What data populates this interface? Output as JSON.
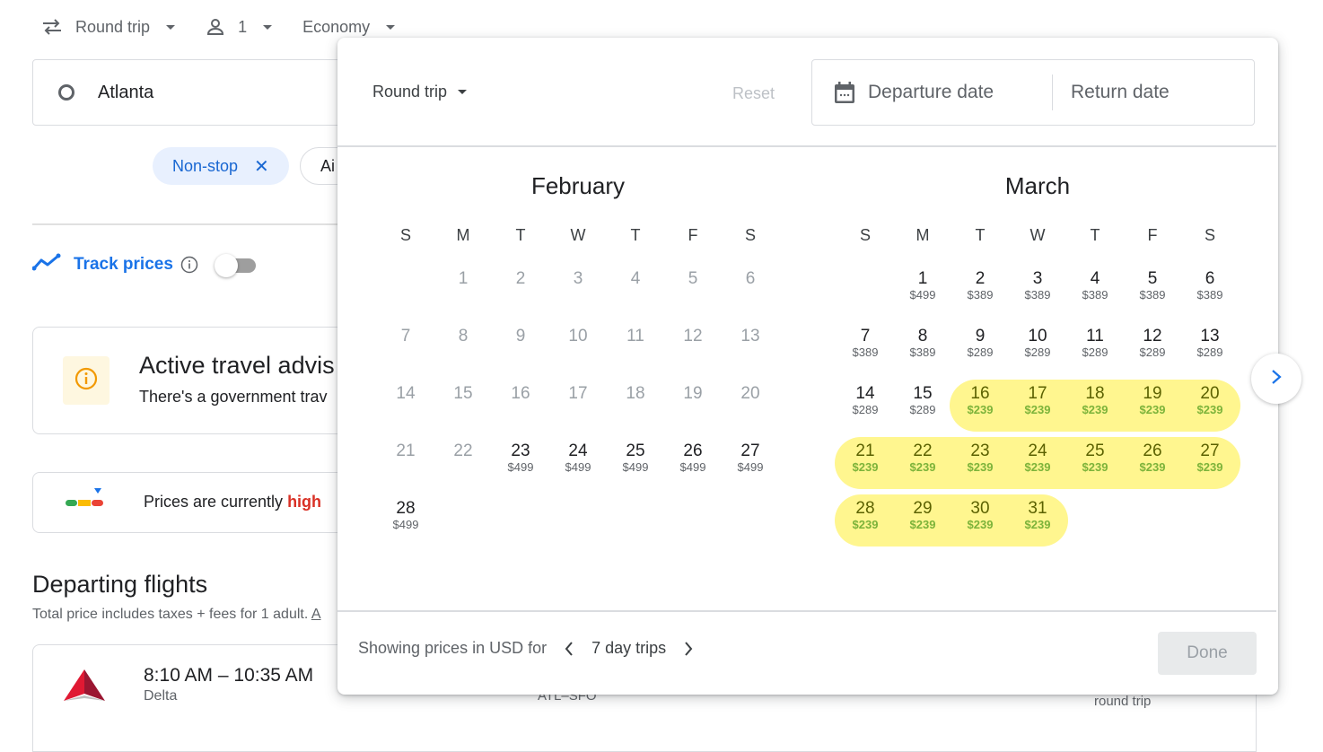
{
  "topbar": {
    "trip_type": "Round trip",
    "passengers": "1",
    "cabin": "Economy"
  },
  "search": {
    "origin": "Atlanta"
  },
  "filters": {
    "nonstop_chip": "Non-stop",
    "airlines_chip": "Ai"
  },
  "track_prices": {
    "label": "Track prices",
    "enabled": false
  },
  "advisory": {
    "title": "Active travel advis",
    "subtitle": "There's a government trav"
  },
  "price_insight": {
    "prefix": "Prices are currently ",
    "level": "high"
  },
  "departing": {
    "title": "Departing flights",
    "subtitle": "Total price includes taxes + fees for 1 adult. ",
    "subtitle_link": "A"
  },
  "flight": {
    "times": "8:10 AM – 10:35 AM",
    "airline": "Delta",
    "route": "ATL–SFO",
    "trip_note": "round trip"
  },
  "date_picker": {
    "trip_type": "Round trip",
    "reset_label": "Reset",
    "departure_placeholder": "Departure date",
    "return_placeholder": "Return date",
    "weekdays": [
      "S",
      "M",
      "T",
      "W",
      "T",
      "F",
      "S"
    ],
    "months": [
      {
        "name": "February",
        "start_weekday": 1,
        "days": [
          {
            "d": "1",
            "p": "",
            "past": true
          },
          {
            "d": "2",
            "p": "",
            "past": true
          },
          {
            "d": "3",
            "p": "",
            "past": true
          },
          {
            "d": "4",
            "p": "",
            "past": true
          },
          {
            "d": "5",
            "p": "",
            "past": true
          },
          {
            "d": "6",
            "p": "",
            "past": true
          },
          {
            "d": "7",
            "p": "",
            "past": true
          },
          {
            "d": "8",
            "p": "",
            "past": true
          },
          {
            "d": "9",
            "p": "",
            "past": true
          },
          {
            "d": "10",
            "p": "",
            "past": true
          },
          {
            "d": "11",
            "p": "",
            "past": true
          },
          {
            "d": "12",
            "p": "",
            "past": true
          },
          {
            "d": "13",
            "p": "",
            "past": true
          },
          {
            "d": "14",
            "p": "",
            "past": true
          },
          {
            "d": "15",
            "p": "",
            "past": true
          },
          {
            "d": "16",
            "p": "",
            "past": true
          },
          {
            "d": "17",
            "p": "",
            "past": true
          },
          {
            "d": "18",
            "p": "",
            "past": true
          },
          {
            "d": "19",
            "p": "",
            "past": true
          },
          {
            "d": "20",
            "p": "",
            "past": true
          },
          {
            "d": "21",
            "p": "",
            "past": true
          },
          {
            "d": "22",
            "p": "",
            "past": true
          },
          {
            "d": "23",
            "p": "$499"
          },
          {
            "d": "24",
            "p": "$499"
          },
          {
            "d": "25",
            "p": "$499"
          },
          {
            "d": "26",
            "p": "$499"
          },
          {
            "d": "27",
            "p": "$499"
          },
          {
            "d": "28",
            "p": "$499"
          }
        ]
      },
      {
        "name": "March",
        "start_weekday": 1,
        "days": [
          {
            "d": "1",
            "p": "$499"
          },
          {
            "d": "2",
            "p": "$389"
          },
          {
            "d": "3",
            "p": "$389"
          },
          {
            "d": "4",
            "p": "$389"
          },
          {
            "d": "5",
            "p": "$389"
          },
          {
            "d": "6",
            "p": "$389"
          },
          {
            "d": "7",
            "p": "$389"
          },
          {
            "d": "8",
            "p": "$389"
          },
          {
            "d": "9",
            "p": "$289"
          },
          {
            "d": "10",
            "p": "$289"
          },
          {
            "d": "11",
            "p": "$289"
          },
          {
            "d": "12",
            "p": "$289"
          },
          {
            "d": "13",
            "p": "$289"
          },
          {
            "d": "14",
            "p": "$289"
          },
          {
            "d": "15",
            "p": "$289"
          },
          {
            "d": "16",
            "p": "$239",
            "cheap": true
          },
          {
            "d": "17",
            "p": "$239",
            "cheap": true
          },
          {
            "d": "18",
            "p": "$239",
            "cheap": true
          },
          {
            "d": "19",
            "p": "$239",
            "cheap": true
          },
          {
            "d": "20",
            "p": "$239",
            "cheap": true
          },
          {
            "d": "21",
            "p": "$239",
            "cheap": true
          },
          {
            "d": "22",
            "p": "$239",
            "cheap": true
          },
          {
            "d": "23",
            "p": "$239",
            "cheap": true
          },
          {
            "d": "24",
            "p": "$239",
            "cheap": true
          },
          {
            "d": "25",
            "p": "$239",
            "cheap": true
          },
          {
            "d": "26",
            "p": "$239",
            "cheap": true
          },
          {
            "d": "27",
            "p": "$239",
            "cheap": true
          },
          {
            "d": "28",
            "p": "$239",
            "cheap": true
          },
          {
            "d": "29",
            "p": "$239",
            "cheap": true
          },
          {
            "d": "30",
            "p": "$239",
            "cheap": true
          },
          {
            "d": "31",
            "p": "$239",
            "cheap": true
          }
        ]
      }
    ],
    "footer_prefix": "Showing prices in USD for",
    "trip_length": "7 day trips",
    "done_label": "Done"
  },
  "colors": {
    "accent_blue": "#1a73e8",
    "cheap_highlight": "#fff68f",
    "cheap_price": "#7cb33a",
    "price_high": "#d93025"
  }
}
